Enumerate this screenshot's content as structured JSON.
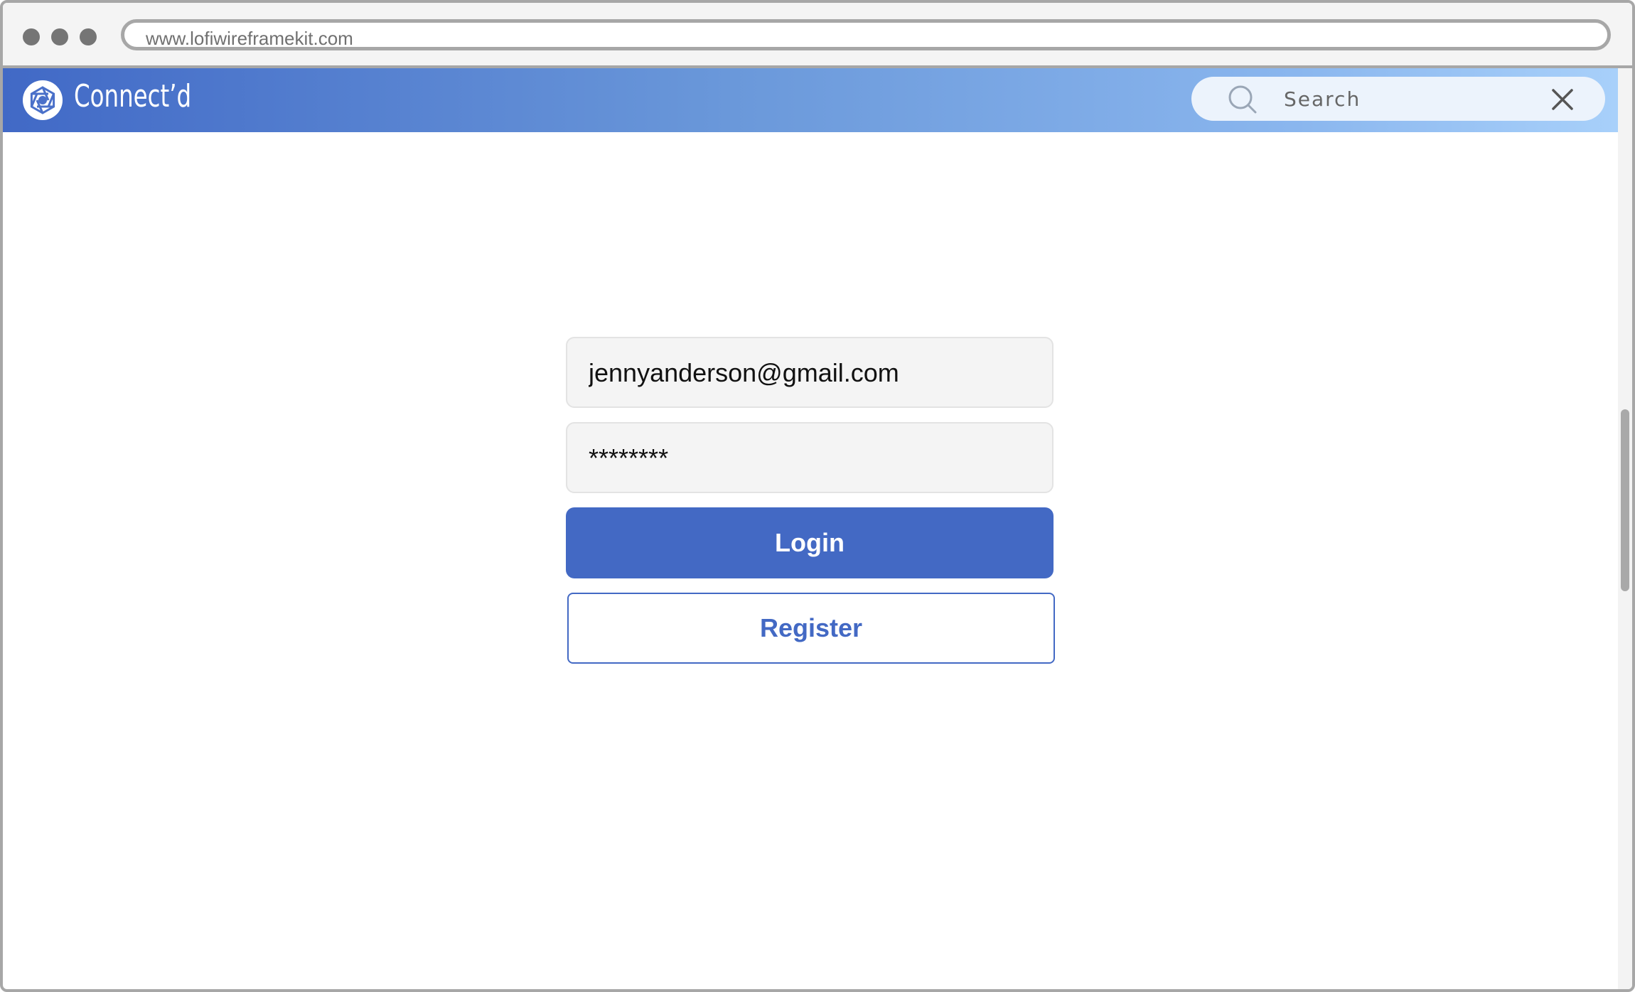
{
  "browser": {
    "url": "www.lofiwireframekit.com"
  },
  "app": {
    "brand": "Connect’d",
    "logo_icon": "aperture-logo-icon",
    "gradient_start": "#4169c6",
    "gradient_end": "#a8d0fa"
  },
  "search": {
    "placeholder": "Search",
    "icon": "search-icon",
    "clear_icon": "close-icon"
  },
  "login_form": {
    "email_value": "jennyanderson@gmail.com",
    "password_value": "********",
    "login_label": "Login",
    "register_label": "Register",
    "accent_color": "#4369c4"
  }
}
